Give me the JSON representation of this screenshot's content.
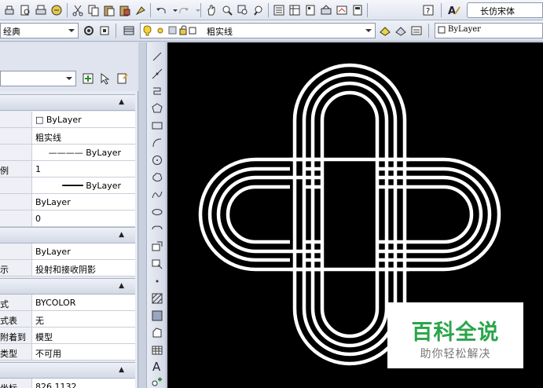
{
  "toolbar": {
    "font_name": "长仿宋体",
    "icons": [
      "print-icon",
      "preview-icon",
      "plot-icon",
      "publish-icon",
      "cut-icon",
      "copy-icon",
      "paste-icon",
      "paste-special-icon",
      "match-properties-icon",
      "undo-icon",
      "redo-icon",
      "pan-icon",
      "zoom-realtime-icon",
      "zoom-window-icon",
      "zoom-previous-icon",
      "properties-icon",
      "design-center-icon",
      "tool-palettes-icon",
      "sheet-set-icon",
      "markup-icon",
      "calculator-icon",
      "help-icon",
      "text-style-icon"
    ]
  },
  "toolbar2": {
    "workspace_label": "经典",
    "layer_name": "粗实线",
    "linetype_label": "ByLayer"
  },
  "palette": {
    "sections": [
      {
        "rows": [
          {
            "name": "",
            "value": "□ ByLayer"
          },
          {
            "name": "",
            "value": "粗实线"
          },
          {
            "name": "",
            "value": "———— ByLayer"
          },
          {
            "name": "例",
            "value": "1"
          },
          {
            "name": "",
            "value": "━━━━ ByLayer"
          },
          {
            "name": "",
            "value": "ByLayer"
          },
          {
            "name": "",
            "value": "0"
          }
        ]
      },
      {
        "rows": [
          {
            "name": "",
            "value": "ByLayer"
          },
          {
            "name": "示",
            "value": "投射和接收阴影"
          }
        ]
      },
      {
        "rows": [
          {
            "name": "式",
            "value": "BYCOLOR"
          },
          {
            "name": "式表",
            "value": "无"
          },
          {
            "name": "附着到",
            "value": "模型"
          },
          {
            "name": "类型",
            "value": "不可用"
          }
        ]
      },
      {
        "rows": [
          {
            "name": "坐标",
            "value": "826.1132"
          }
        ]
      }
    ]
  },
  "drawbar": {
    "icons": [
      "line-icon",
      "construction-line-icon",
      "polyline-icon",
      "polygon-icon",
      "rectangle-icon",
      "arc-icon",
      "circle-icon",
      "revision-cloud-icon",
      "spline-icon",
      "ellipse-icon",
      "ellipse-arc-icon",
      "insert-block-icon",
      "make-block-icon",
      "point-icon",
      "hatch-icon",
      "gradient-icon",
      "region-icon",
      "table-icon",
      "multiline-text-icon",
      "add-selected-icon"
    ]
  },
  "watermark": {
    "title": "百科全说",
    "subtitle": "助你轻松解决"
  },
  "colors": {
    "canvas_bg": "#000000",
    "drawing_stroke": "#ffffff",
    "watermark_green": "#2aa54a"
  }
}
